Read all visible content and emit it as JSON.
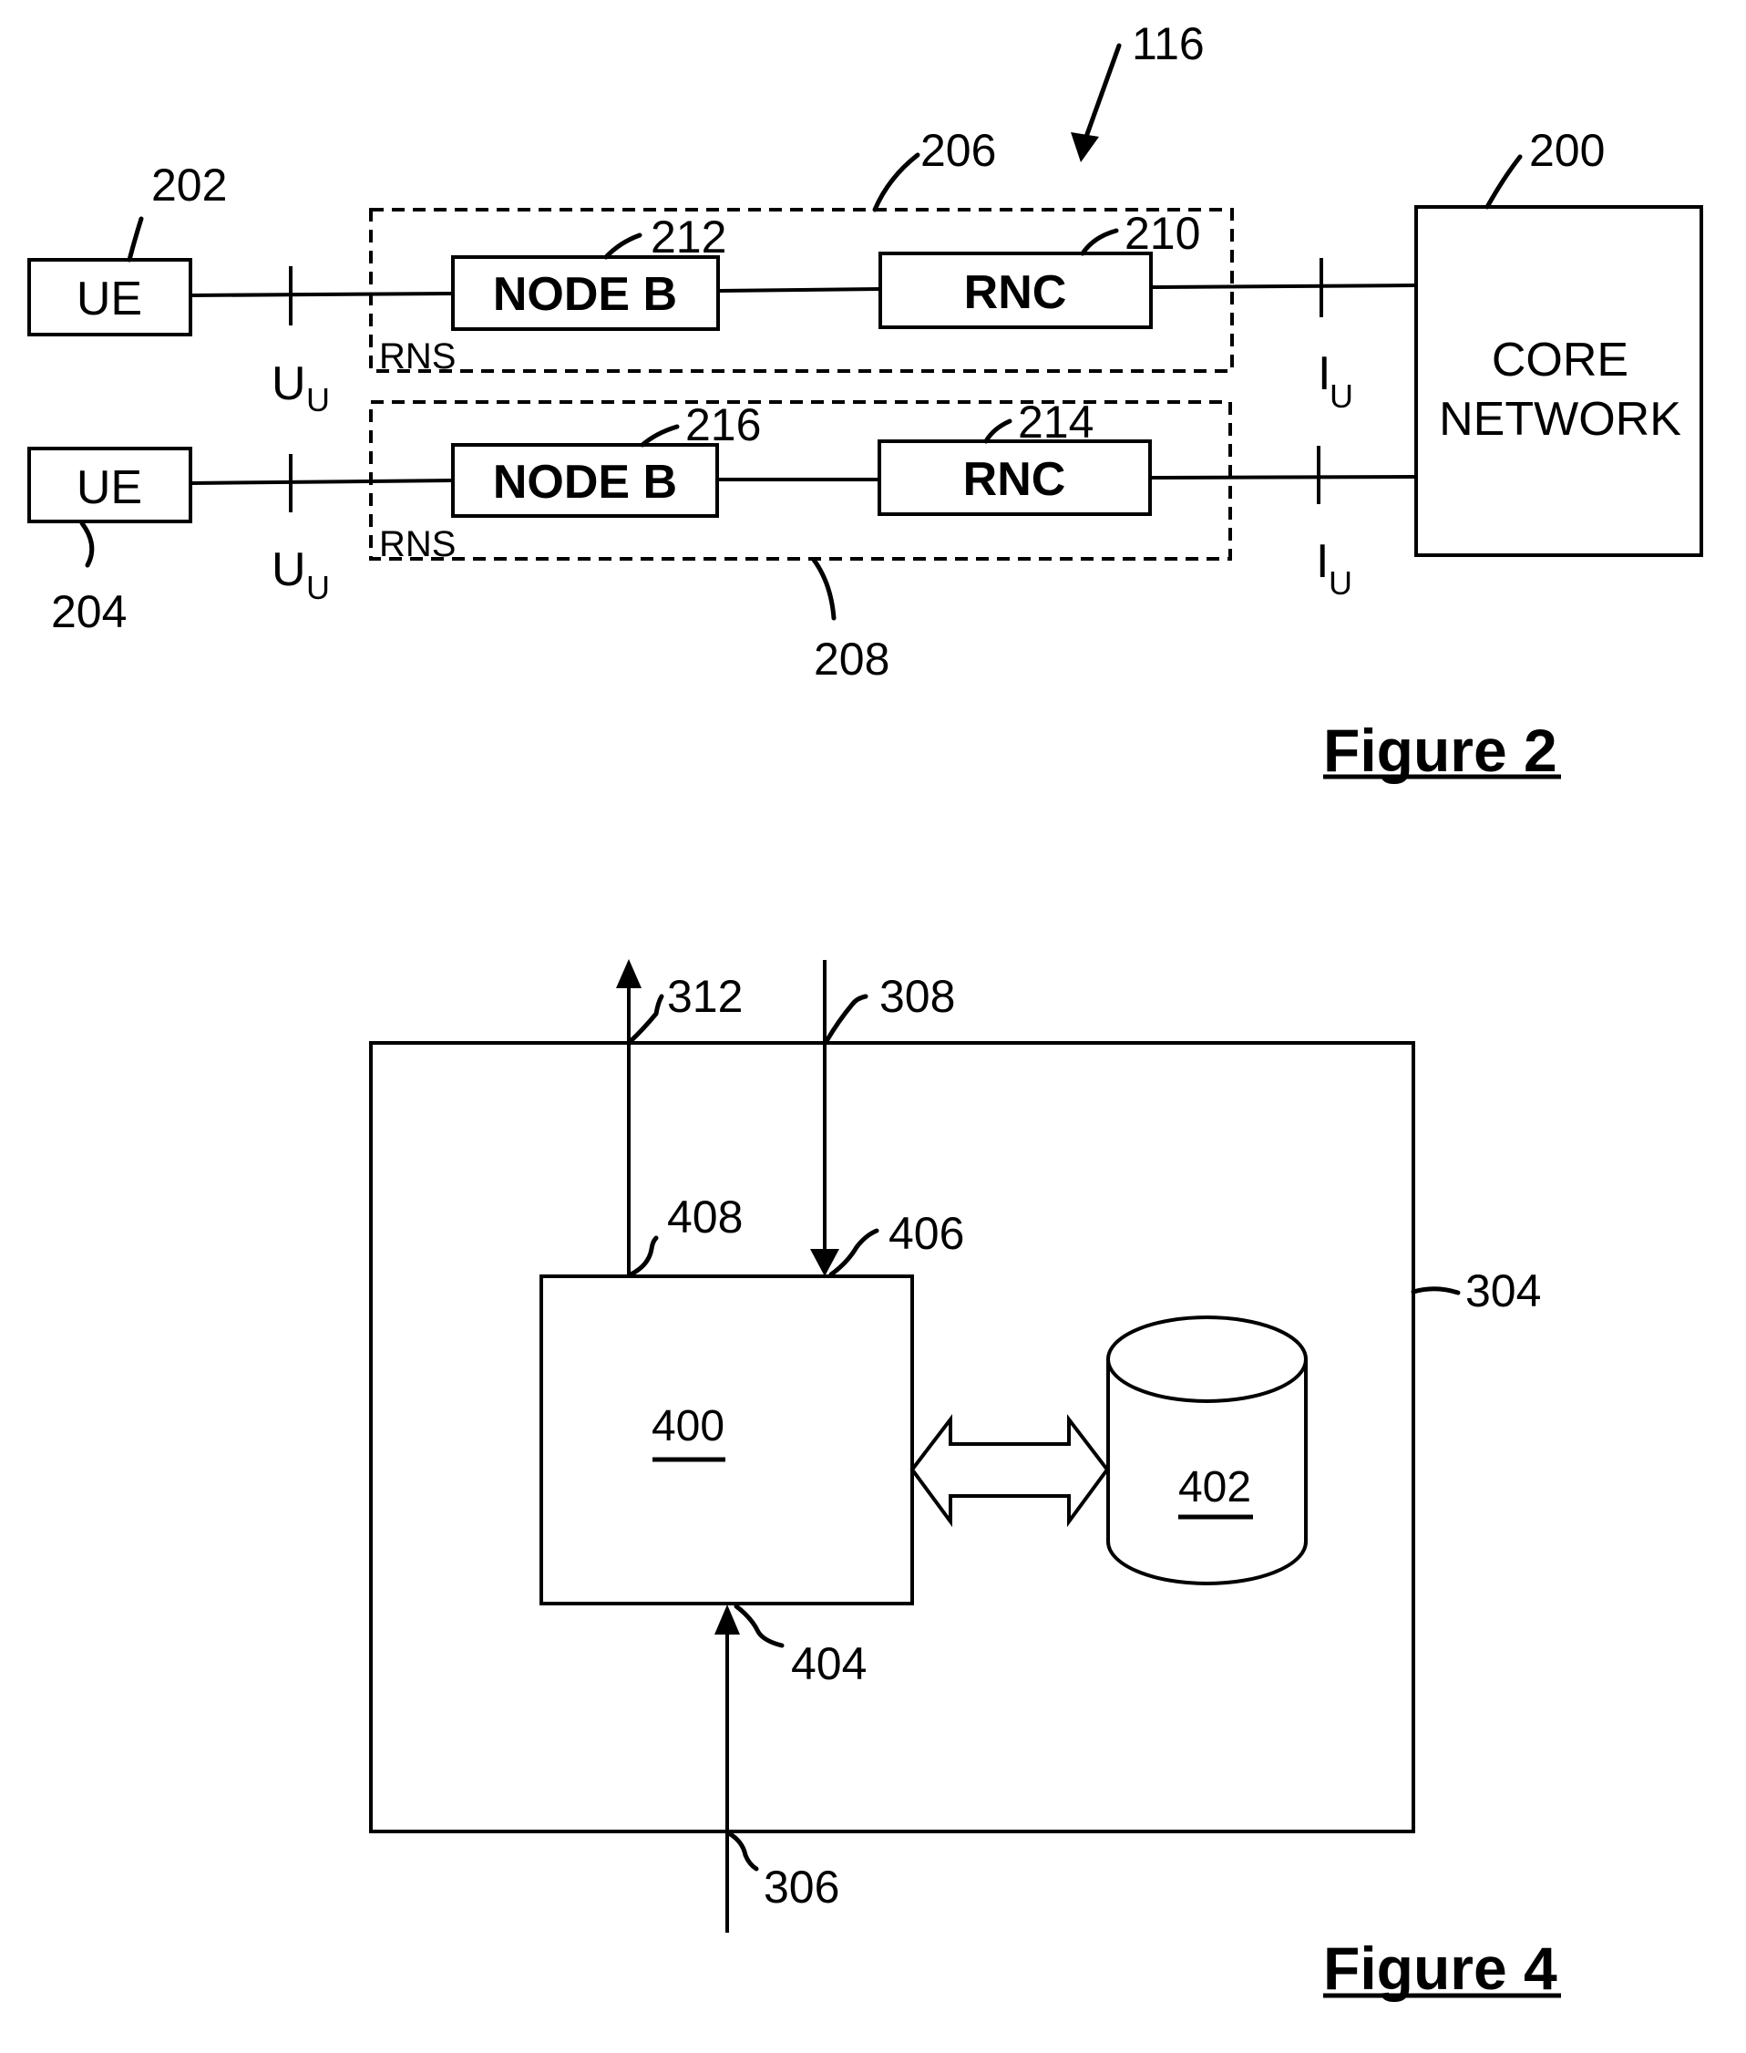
{
  "figure2": {
    "title": "Figure 2",
    "system_ref": "116",
    "core_network": {
      "ref": "200",
      "line1": "CORE",
      "line2": "NETWORK"
    },
    "rows": [
      {
        "ue": {
          "label": "UE",
          "ref": "202"
        },
        "uu_interface": {
          "main": "U",
          "sub": "U"
        },
        "rns": {
          "label": "RNS",
          "ref": "206"
        },
        "node_b": {
          "label": "NODE B",
          "ref": "212"
        },
        "rnc": {
          "label": "RNC",
          "ref": "210"
        },
        "iu_interface": {
          "main": "I",
          "sub": "U"
        }
      },
      {
        "ue": {
          "label": "UE",
          "ref": "204"
        },
        "uu_interface": {
          "main": "U",
          "sub": "U"
        },
        "rns": {
          "label": "RNS",
          "ref": "208"
        },
        "node_b": {
          "label": "NODE B",
          "ref": "216"
        },
        "rnc": {
          "label": "RNC",
          "ref": "214"
        },
        "iu_interface": {
          "main": "I",
          "sub": "U"
        }
      }
    ]
  },
  "figure4": {
    "title": "Figure 4",
    "outer_ref": "304",
    "processor_ref": "400",
    "storage_ref": "402",
    "output_arrow_ref": "312",
    "input_arrow_top_ref": "308",
    "input_arrow_bottom_ref": "306",
    "port_output_ref": "408",
    "port_input_top_ref": "406",
    "port_input_bottom_ref": "404"
  }
}
